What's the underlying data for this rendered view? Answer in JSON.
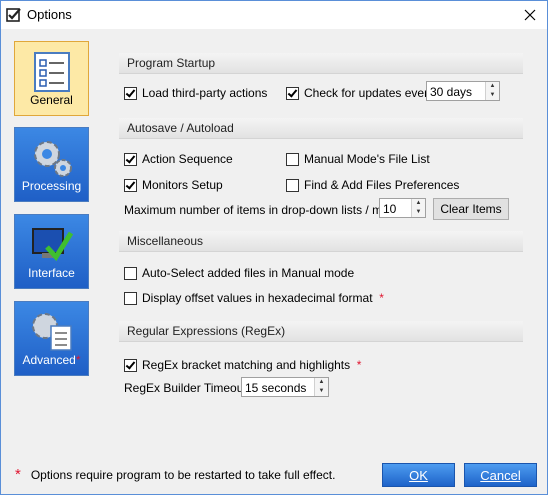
{
  "window": {
    "title": "Options"
  },
  "sidebar": [
    {
      "label": "General",
      "star": ""
    },
    {
      "label": "Processing",
      "star": ""
    },
    {
      "label": "Interface",
      "star": ""
    },
    {
      "label": "Advanced",
      "star": "*"
    }
  ],
  "sections": {
    "startup": "Program Startup",
    "autosave": "Autosave / Autoload",
    "misc": "Miscellaneous",
    "regex": "Regular Expressions (RegEx)"
  },
  "options": {
    "load_third_party": {
      "label": "Load third-party actions",
      "checked": true
    },
    "check_updates": {
      "label": "Check for updates every",
      "checked": true,
      "value": "30 days"
    },
    "action_sequence": {
      "label": "Action Sequence",
      "checked": true
    },
    "manual_file_list": {
      "label": "Manual Mode's File List",
      "checked": false
    },
    "monitors_setup": {
      "label": "Monitors Setup",
      "checked": true
    },
    "find_add_prefs": {
      "label": "Find & Add Files Preferences",
      "checked": false
    },
    "max_items_label": "Maximum number of items in drop-down lists / menus:",
    "max_items_value": "10",
    "clear_items": "Clear Items",
    "auto_select": {
      "label": "Auto-Select added files in Manual mode",
      "checked": false
    },
    "hex_offset": {
      "label": "Display offset values in hexadecimal format",
      "checked": false,
      "star": "*"
    },
    "regex_bracket": {
      "label": "RegEx bracket matching and highlights",
      "checked": true,
      "star": "*"
    },
    "regex_timeout_label": "RegEx Builder Timeout:",
    "regex_timeout_value": "15 seconds"
  },
  "footer": {
    "star": "*",
    "note": "Options require program to be restarted to take full effect.",
    "ok": "OK",
    "cancel": "Cancel"
  }
}
